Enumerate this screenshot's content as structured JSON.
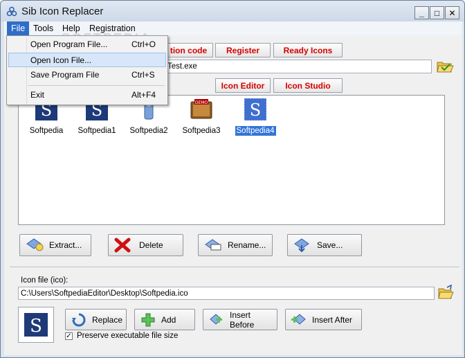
{
  "window": {
    "title": "Sib Icon Replacer",
    "controls": {
      "minimize": "_",
      "maximize": "□",
      "close": "✕"
    }
  },
  "menu": [
    "File",
    "Tools",
    "Help",
    "Registration"
  ],
  "watermark": "SOFTPEDIA",
  "file_menu": {
    "items": [
      {
        "label": "Open Program File...",
        "shortcut": "Ctrl+O"
      },
      {
        "label": "Open Icon File...",
        "shortcut": ""
      },
      {
        "label": "Save Program File",
        "shortcut": "Ctrl+S"
      },
      {
        "label": "Exit",
        "shortcut": "Alt+F4"
      }
    ]
  },
  "toolbar": {
    "registration_code": "tion code",
    "register": "Register",
    "ready_icons": "Ready Icons",
    "icon_editor": "Icon Editor",
    "icon_studio": "Icon Studio"
  },
  "program_path": "Test.exe",
  "icons": [
    {
      "label": "Softpedia",
      "selected": false
    },
    {
      "label": "Softpedia1",
      "selected": false
    },
    {
      "label": "Softpedia2",
      "selected": false
    },
    {
      "label": "Softpedia3",
      "selected": false
    },
    {
      "label": "Softpedia4",
      "selected": true
    }
  ],
  "demo_badge": "DEMO",
  "actions": {
    "extract": "Extract...",
    "delete": "Delete",
    "rename": "Rename...",
    "save": "Save..."
  },
  "icon_file": {
    "label": "Icon file (ico):",
    "path": "C:\\Users\\SoftpediaEditor\\Desktop\\Softpedia.ico",
    "preview_letter": "S"
  },
  "icon_actions": {
    "replace": "Replace",
    "add": "Add",
    "insert_before": "Insert Before",
    "insert_after": "Insert After"
  },
  "preserve_checkbox": {
    "label": "Preserve executable file size",
    "checked": true
  },
  "colors": {
    "accent_red": "#d40000",
    "selection_blue": "#3374d8",
    "icon_navy": "#1e3a78"
  }
}
